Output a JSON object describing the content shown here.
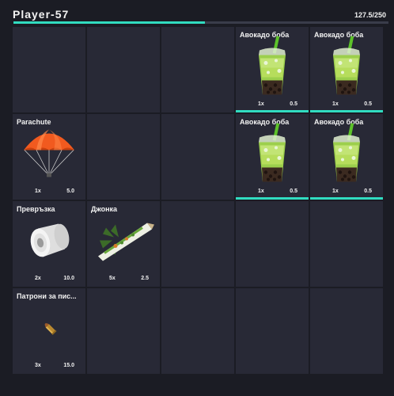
{
  "player": {
    "name": "Player-57"
  },
  "weight": {
    "text": "127.5/250",
    "fraction": 0.51
  },
  "accent_color": "#31dcc0",
  "slots": [
    {
      "name": "",
      "qty": "",
      "weight": "",
      "icon": ""
    },
    {
      "name": "",
      "qty": "",
      "weight": "",
      "icon": ""
    },
    {
      "name": "",
      "qty": "",
      "weight": "",
      "icon": ""
    },
    {
      "name": "Авокадо боба",
      "qty": "1x",
      "weight": "0.5",
      "icon": "bubble-tea-icon",
      "selected": true
    },
    {
      "name": "Авокадо боба",
      "qty": "1x",
      "weight": "0.5",
      "icon": "bubble-tea-icon",
      "selected": true
    },
    {
      "name": "Parachute",
      "qty": "1x",
      "weight": "5.0",
      "icon": "parachute-icon"
    },
    {
      "name": "",
      "qty": "",
      "weight": "",
      "icon": ""
    },
    {
      "name": "",
      "qty": "",
      "weight": "",
      "icon": ""
    },
    {
      "name": "Авокадо боба",
      "qty": "1x",
      "weight": "0.5",
      "icon": "bubble-tea-icon",
      "selected": true
    },
    {
      "name": "Авокадо боба",
      "qty": "1x",
      "weight": "0.5",
      "icon": "bubble-tea-icon",
      "selected": true
    },
    {
      "name": "Превръзка",
      "qty": "2x",
      "weight": "10.0",
      "icon": "bandage-roll-icon"
    },
    {
      "name": "Джонка",
      "qty": "5x",
      "weight": "2.5",
      "icon": "joint-icon"
    },
    {
      "name": "",
      "qty": "",
      "weight": "",
      "icon": ""
    },
    {
      "name": "",
      "qty": "",
      "weight": "",
      "icon": ""
    },
    {
      "name": "",
      "qty": "",
      "weight": "",
      "icon": ""
    },
    {
      "name": "Патрони за пис...",
      "qty": "3x",
      "weight": "15.0",
      "icon": "bullet-icon"
    },
    {
      "name": "",
      "qty": "",
      "weight": "",
      "icon": ""
    },
    {
      "name": "",
      "qty": "",
      "weight": "",
      "icon": ""
    },
    {
      "name": "",
      "qty": "",
      "weight": "",
      "icon": ""
    },
    {
      "name": "",
      "qty": "",
      "weight": "",
      "icon": ""
    }
  ]
}
